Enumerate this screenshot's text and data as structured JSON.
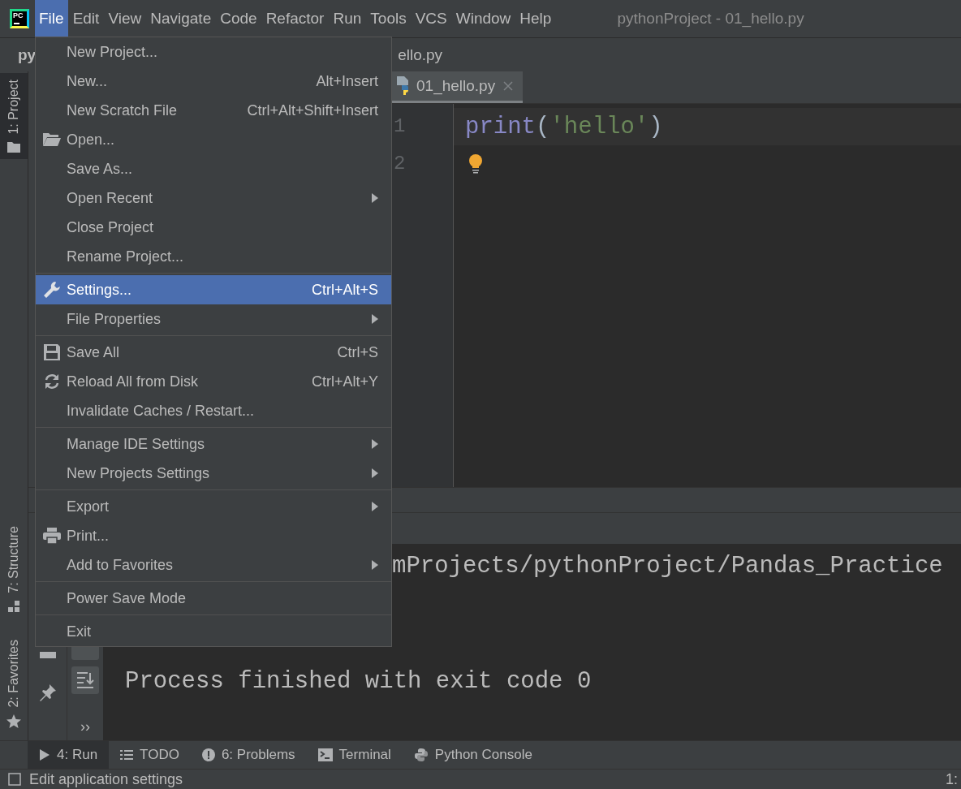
{
  "menubar": {
    "items": [
      {
        "label": "File",
        "selected": true
      },
      {
        "label": "Edit",
        "selected": false
      },
      {
        "label": "View",
        "selected": false
      },
      {
        "label": "Navigate",
        "selected": false
      },
      {
        "label": "Code",
        "selected": false
      },
      {
        "label": "Refactor",
        "selected": false
      },
      {
        "label": "Run",
        "selected": false
      },
      {
        "label": "Tools",
        "selected": false
      },
      {
        "label": "VCS",
        "selected": false
      },
      {
        "label": "Window",
        "selected": false
      },
      {
        "label": "Help",
        "selected": false
      }
    ],
    "title": "pythonProject - 01_hello.py"
  },
  "logo_text": "PC",
  "breadcrumb": [
    "py",
    "ello.py"
  ],
  "left_tool_strip": {
    "tabs": [
      {
        "label": "1: Project",
        "selected": true
      },
      {
        "label": "7: Structure",
        "selected": false
      },
      {
        "label": "2: Favorites",
        "selected": false
      }
    ]
  },
  "editor": {
    "tabs": [
      {
        "label": "01_hello.py",
        "selected": true
      }
    ],
    "line_numbers": [
      "1",
      "2"
    ],
    "code": [
      {
        "kind": "builtin",
        "text": "print"
      },
      {
        "kind": "punct",
        "text": "("
      },
      {
        "kind": "string",
        "text": "'hello'"
      },
      {
        "kind": "punct",
        "text": ")"
      }
    ]
  },
  "run_panel": {
    "more": "››",
    "console_lines": [
      "mProjects/pythonProject/Pandas_Practice",
      "Process finished with exit code 0"
    ]
  },
  "bottom_toolbar": {
    "tabs": [
      {
        "label": "4: Run",
        "selected": true
      },
      {
        "label": "TODO",
        "selected": false
      },
      {
        "label": "6: Problems",
        "selected": false
      },
      {
        "label": "Terminal",
        "selected": false
      },
      {
        "label": "Python Console",
        "selected": false
      }
    ]
  },
  "status_bar": {
    "message": "Edit application settings",
    "position": "1:"
  },
  "file_menu": {
    "groups": [
      [
        {
          "label": "New Project...",
          "kind": "command",
          "selected": false
        },
        {
          "label": "New...",
          "shortcut": "Alt+Insert",
          "kind": "command",
          "selected": false
        },
        {
          "label": "New Scratch File",
          "shortcut": "Ctrl+Alt+Shift+Insert",
          "kind": "command",
          "selected": false
        },
        {
          "label": "Open...",
          "kind": "command",
          "selected": false
        },
        {
          "label": "Save As...",
          "kind": "command",
          "selected": false
        },
        {
          "label": "Open Recent",
          "kind": "submenu",
          "selected": false
        },
        {
          "label": "Close Project",
          "kind": "command",
          "selected": false
        },
        {
          "label": "Rename Project...",
          "kind": "command",
          "selected": false
        }
      ],
      [
        {
          "label": "Settings...",
          "shortcut": "Ctrl+Alt+S",
          "kind": "command",
          "selected": true
        },
        {
          "label": "File Properties",
          "kind": "submenu",
          "selected": false
        }
      ],
      [
        {
          "label": "Save All",
          "shortcut": "Ctrl+S",
          "kind": "command",
          "selected": false
        },
        {
          "label": "Reload All from Disk",
          "shortcut": "Ctrl+Alt+Y",
          "kind": "command",
          "selected": false
        },
        {
          "label": "Invalidate Caches / Restart...",
          "kind": "command",
          "selected": false
        }
      ],
      [
        {
          "label": "Manage IDE Settings",
          "kind": "submenu",
          "selected": false
        },
        {
          "label": "New Projects Settings",
          "kind": "submenu",
          "selected": false
        }
      ],
      [
        {
          "label": "Export",
          "kind": "submenu",
          "selected": false
        },
        {
          "label": "Print...",
          "kind": "command",
          "selected": false
        },
        {
          "label": "Add to Favorites",
          "kind": "submenu",
          "selected": false
        }
      ],
      [
        {
          "label": "Power Save Mode",
          "kind": "command",
          "selected": false
        }
      ],
      [
        {
          "label": "Exit",
          "kind": "command",
          "selected": false
        }
      ]
    ]
  }
}
